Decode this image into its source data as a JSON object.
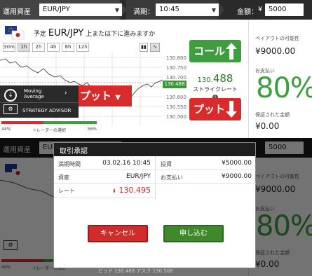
{
  "header": {
    "asset_label": "運用資産",
    "asset_value": "EUR/JPY",
    "expiry_label": "満期：",
    "expiry_value": "10:45",
    "amount_label": "金額：",
    "currency_symbol": "¥",
    "amount_value": "5000"
  },
  "trade": {
    "prediction_prefix": "予定",
    "pair": "EUR/JPY",
    "prediction_suffix": "上または下に進みますか",
    "timeframes": [
      "30m",
      "1h",
      "2h",
      "4h",
      "8h",
      "12h"
    ],
    "selected_timeframe": "1h",
    "y_ticks": [
      "130.800",
      "130.750",
      "130.700",
      "130.650",
      "130.600",
      "130.550",
      "130.500"
    ],
    "current_price_tag": "130.488",
    "call_label": "コール",
    "put_label": "プット",
    "strike_main": "130.",
    "strike_decimals": "488",
    "strike_label": "ストライクレート",
    "colors": {
      "call": "#3e9d3e",
      "put": "#d92b2b"
    }
  },
  "payout": {
    "possible_label": "ペイアウトの可能性",
    "possible_value": "¥9000.00",
    "payout_label": "お支払い",
    "percent": "80%",
    "guaranteed_label": "保証された金額",
    "guaranteed_value": "¥0.00"
  },
  "advisor": {
    "indicator_name_1": "Moving",
    "indicator_name_2": "Average",
    "advisor_label": "STRATEGY ADVISOR"
  },
  "sentiment": {
    "put_pct_label": "44%",
    "call_pct_label": "56%",
    "put_fraction": 0.44,
    "caption": "トレーダーの選択"
  },
  "modal": {
    "title": "取引承認",
    "expiry_label": "満期時間",
    "expiry_value": "03.02.16 10:45",
    "asset_label": "資産",
    "asset_value": "EUR/JPY",
    "rate_label": "レート",
    "rate_value": "130.495",
    "invest_label": "投資",
    "invest_value": "¥5000.00",
    "payout_label": "お支払い",
    "payout_value": "¥9000.00",
    "cancel_label": "キャンセル",
    "confirm_label": "申し込む"
  },
  "bottom": {
    "bid": "ビッド 130.468",
    "ask": "アスク 130.508"
  }
}
